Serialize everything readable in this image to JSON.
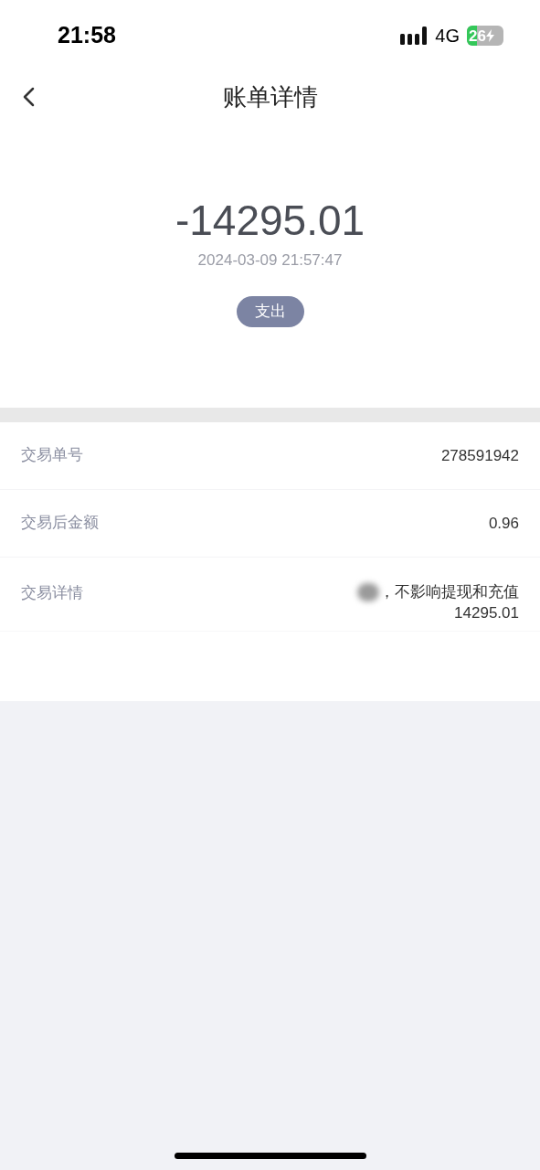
{
  "status_bar": {
    "time": "21:58",
    "network": "4G",
    "battery": "26",
    "charging": true
  },
  "header": {
    "title": "账单详情"
  },
  "summary": {
    "amount": "-14295.01",
    "datetime": "2024-03-09 21:57:47",
    "tag": "支出"
  },
  "details": [
    {
      "label": "交易单号",
      "value_lines": [
        "278591942"
      ],
      "redacted": false
    },
    {
      "label": "交易后金额",
      "value_lines": [
        "0.96"
      ],
      "redacted": false
    },
    {
      "label": "交易详情",
      "value_lines": [
        "，不影响提现和充值",
        "14295.01"
      ],
      "redacted": true
    }
  ]
}
